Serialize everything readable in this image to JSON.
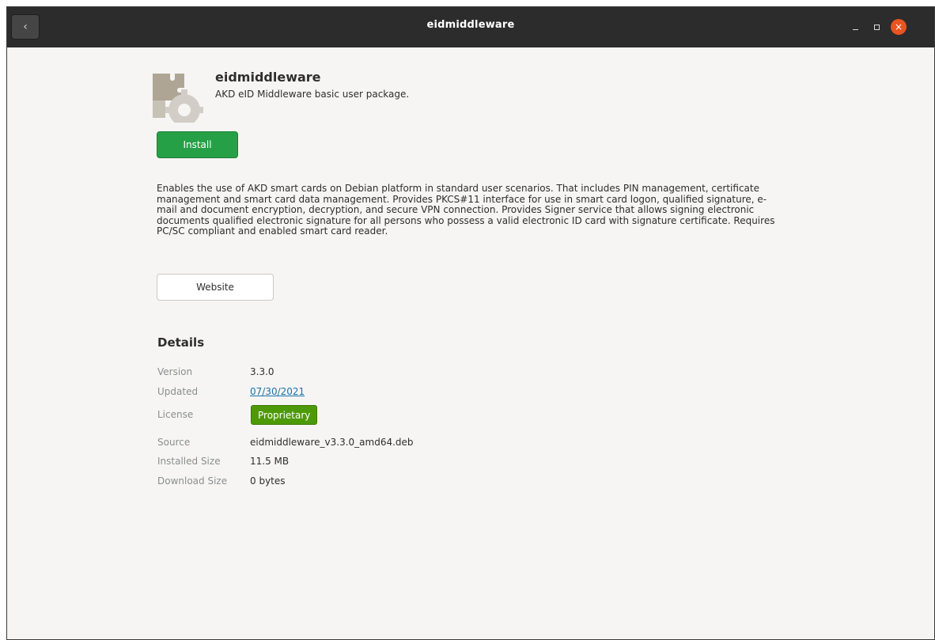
{
  "window": {
    "title": "eidmiddleware",
    "back_glyph": "‹",
    "close_glyph": "×"
  },
  "app": {
    "name": "eidmiddleware",
    "summary": "AKD eID Middleware basic user package.",
    "icon": "puzzle-gear-icon",
    "install_label": "Install",
    "description": "Enables the use of AKD smart cards on Debian platform in standard user scenarios.  That includes PIN management, certificate management and smart card data management. Provides PKCS#11 interface for use in smart card logon, qualified signature, e-mail  and document encryption, decryption, and secure VPN connection. Provides Signer service that allows signing electronic documents qualified electronic signature for all persons  who possess a valid electronic ID card with signature certificate. Requires PC/SC compliant and enabled smart card reader.",
    "website_label": "Website"
  },
  "details": {
    "heading": "Details",
    "version": {
      "label": "Version",
      "value": "3.3.0"
    },
    "updated": {
      "label": "Updated",
      "value": "07/30/2021"
    },
    "license": {
      "label": "License",
      "value": "Proprietary"
    },
    "source": {
      "label": "Source",
      "value": "eidmiddleware_v3.3.0_amd64.deb"
    },
    "installed_size": {
      "label": "Installed Size",
      "value": "11.5 MB"
    },
    "download_size": {
      "label": "Download Size",
      "value": "0 bytes"
    }
  },
  "colors": {
    "install_green": "#26a046",
    "license_green": "#4e9a06",
    "close_orange": "#e95420",
    "titlebar": "#2c2c2c"
  }
}
